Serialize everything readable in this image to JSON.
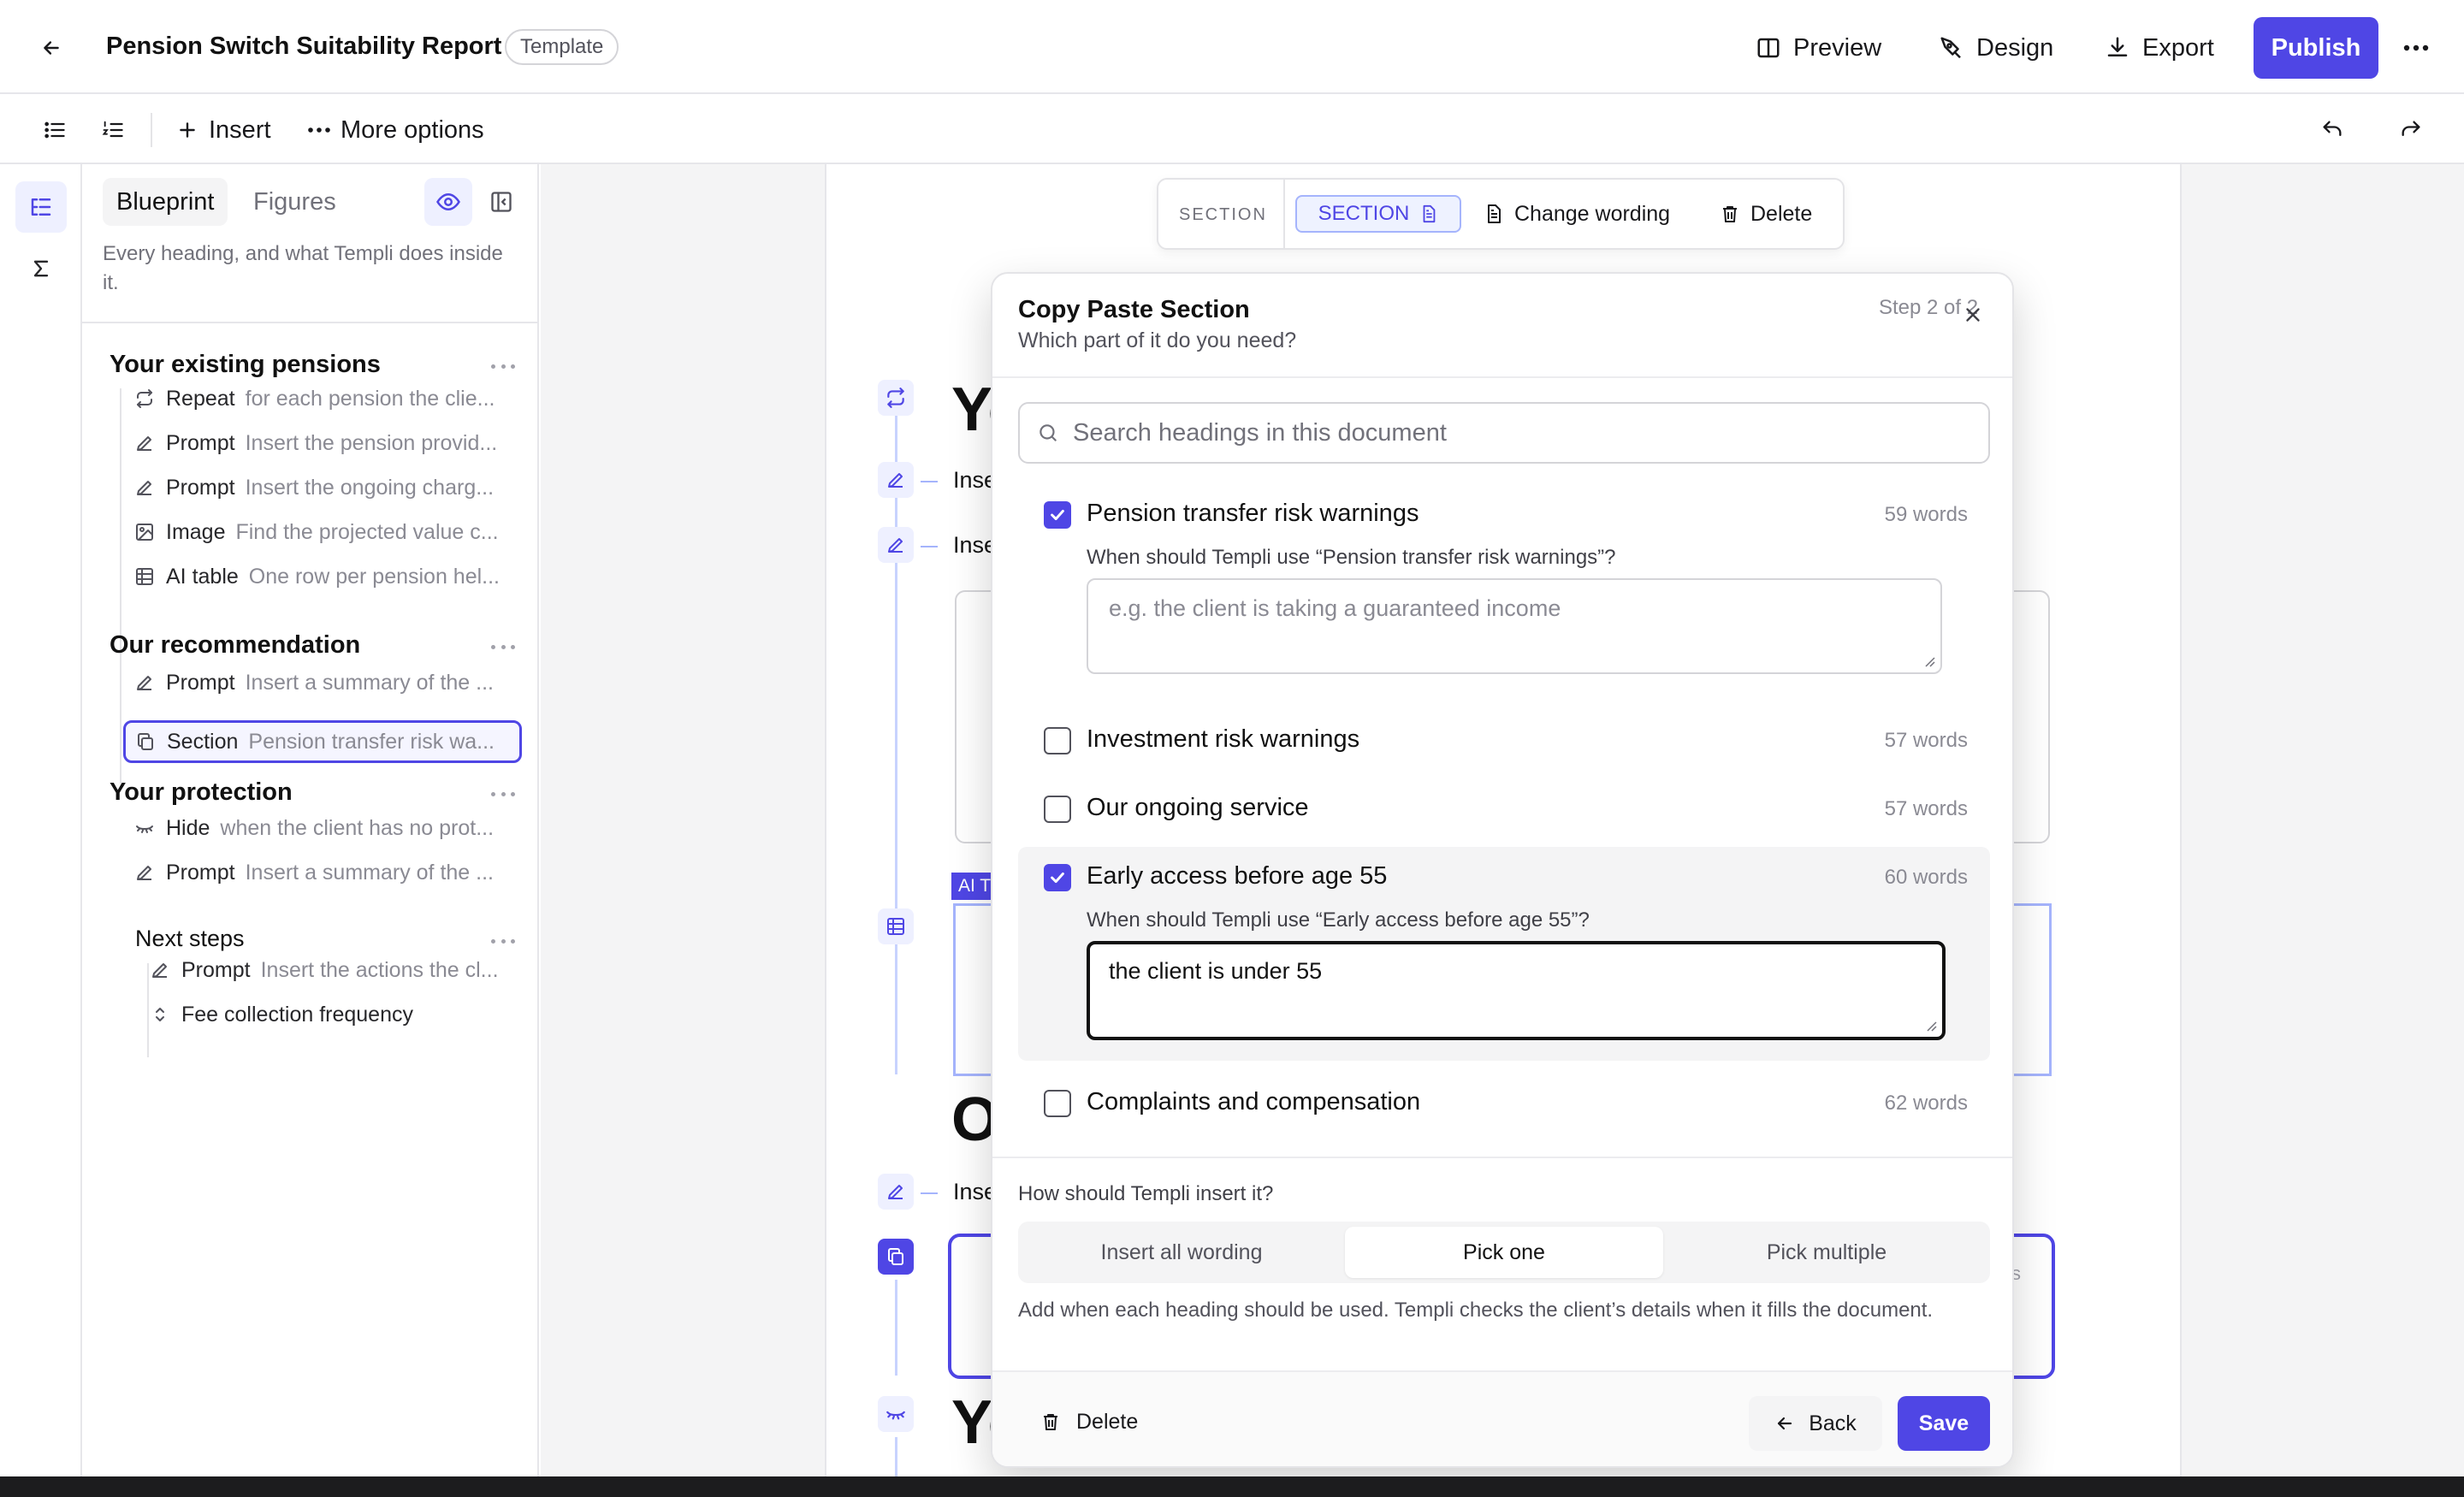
{
  "header": {
    "title": "Pension Switch Suitability Report",
    "badge": "Template",
    "preview": "Preview",
    "design": "Design",
    "export": "Export",
    "publish": "Publish"
  },
  "toolbar": {
    "insert": "Insert",
    "more": "More options"
  },
  "panel": {
    "tabs": [
      "Blueprint",
      "Figures"
    ],
    "description": "Every heading, and what Templi does inside it.",
    "groups": [
      {
        "title": "Your existing pensions",
        "items": [
          {
            "kind": "Repeat",
            "desc": "for each pension the clie...",
            "icon": "repeat-icon"
          },
          {
            "kind": "Prompt",
            "desc": "Insert the pension provid...",
            "icon": "pencil-icon"
          },
          {
            "kind": "Prompt",
            "desc": "Insert the ongoing charg...",
            "icon": "pencil-icon"
          },
          {
            "kind": "Image",
            "desc": "Find the projected value c...",
            "icon": "image-icon"
          },
          {
            "kind": "AI table",
            "desc": "One row per pension hel...",
            "icon": "table-icon"
          }
        ]
      },
      {
        "title": "Our recommendation",
        "items": [
          {
            "kind": "Prompt",
            "desc": "Insert a summary of the ...",
            "icon": "pencil-icon"
          },
          {
            "kind": "Section",
            "desc": "Pension transfer risk wa...",
            "icon": "copy-icon",
            "selected": true
          }
        ]
      },
      {
        "title": "Your protection",
        "items": [
          {
            "kind": "Hide",
            "desc": "when the client has no prot...",
            "icon": "eye-closed-icon"
          },
          {
            "kind": "Prompt",
            "desc": "Insert a summary of the ...",
            "icon": "pencil-icon"
          }
        ]
      },
      {
        "title": "Next steps",
        "items": [
          {
            "kind": "Prompt",
            "desc": "Insert the actions the cl...",
            "icon": "pencil-icon"
          },
          {
            "kind": "Fee collection frequency",
            "desc": "",
            "icon": "chevron-updown-icon"
          }
        ]
      }
    ]
  },
  "canvas": {
    "floating": {
      "label": "SECTION",
      "chip": "SECTION",
      "change": "Change wording",
      "delete": "Delete"
    },
    "heading1": "Yo",
    "heading2": "O",
    "heading3": "Yo",
    "insert_text": "Inse",
    "ai_tag": "AI T",
    "section_peek": "s"
  },
  "modal": {
    "title": "Copy Paste Section",
    "subtitle": "Which part of it do you need?",
    "step": "Step 2 of 2",
    "search_placeholder": "Search headings in this document",
    "options": [
      {
        "label": "Pension transfer risk warnings",
        "words": "59 words",
        "checked": true,
        "question": "When should Templi use “Pension transfer risk warnings”?",
        "placeholder": "e.g. the client is taking a guaranteed income",
        "value": ""
      },
      {
        "label": "Investment risk warnings",
        "words": "57 words",
        "checked": false
      },
      {
        "label": "Our ongoing service",
        "words": "57 words",
        "checked": false
      },
      {
        "label": "Early access before age 55",
        "words": "60 words",
        "checked": true,
        "question": "When should Templi use “Early access before age 55”?",
        "placeholder": "",
        "value": "the client is under 55"
      },
      {
        "label": "Complaints and compensation",
        "words": "62 words",
        "checked": false
      }
    ],
    "how_label": "How should Templi insert it?",
    "modes": [
      "Insert all wording",
      "Pick one",
      "Pick multiple"
    ],
    "active_mode": "Pick one",
    "help": "Add when each heading should be used. Templi checks the client’s details when it fills the document.",
    "delete": "Delete",
    "back": "Back",
    "save": "Save"
  },
  "colors": {
    "accent": "#4f46e5",
    "accent_light": "#eef0ff"
  }
}
